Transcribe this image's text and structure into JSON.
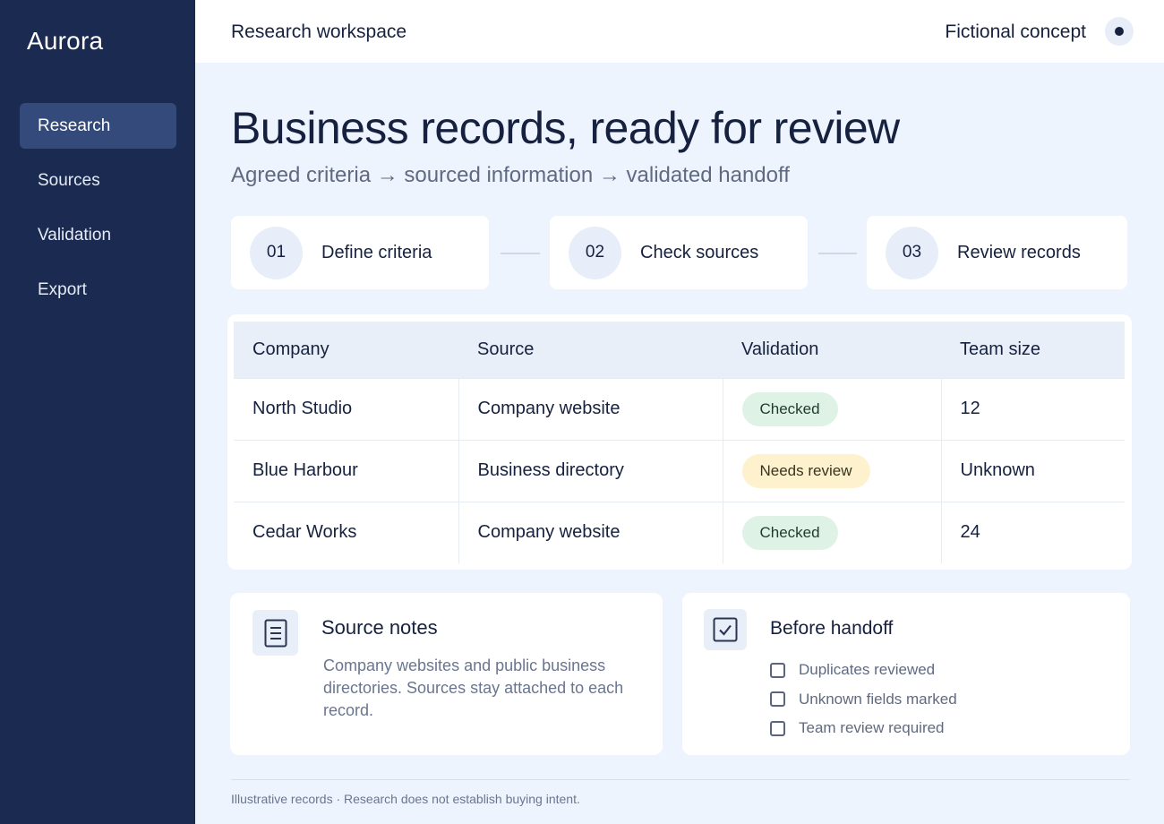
{
  "app": {
    "brand": "Aurora"
  },
  "sidebar": {
    "items": [
      {
        "label": "Research",
        "active": true
      },
      {
        "label": "Sources",
        "active": false
      },
      {
        "label": "Validation",
        "active": false
      },
      {
        "label": "Export",
        "active": false
      }
    ]
  },
  "topbar": {
    "workspace": "Research workspace",
    "concept_label": "Fictional concept"
  },
  "hero": {
    "title": "Business records, ready for review",
    "subtitle": "Agreed criteria → sourced information → validated handoff"
  },
  "steps": [
    {
      "number": "01",
      "label": "Define criteria"
    },
    {
      "number": "02",
      "label": "Check sources"
    },
    {
      "number": "03",
      "label": "Review records"
    }
  ],
  "table": {
    "columns": [
      "Company",
      "Source",
      "Validation",
      "Team size"
    ],
    "rows": [
      {
        "company": "North Studio",
        "source": "Company website",
        "validation": "Checked",
        "status": "checked",
        "team_size": "12"
      },
      {
        "company": "Blue Harbour",
        "source": "Business directory",
        "validation": "Needs review",
        "status": "review",
        "team_size": "Unknown"
      },
      {
        "company": "Cedar Works",
        "source": "Company website",
        "validation": "Checked",
        "status": "checked",
        "team_size": "24"
      }
    ]
  },
  "source_notes": {
    "title": "Source notes",
    "body": "Company websites and public business directories. Sources stay attached to each record."
  },
  "handoff": {
    "title": "Before handoff",
    "items": [
      {
        "label": "Duplicates reviewed",
        "checked": false
      },
      {
        "label": "Unknown fields marked",
        "checked": false
      },
      {
        "label": "Team review required",
        "checked": false
      }
    ]
  },
  "footer": {
    "note": "Illustrative records · Research does not establish buying intent."
  },
  "colors": {
    "sidebar": "#1b2a50",
    "sidebar_active": "#344a7a",
    "background": "#eef4fd",
    "badge_checked": "#def3e6",
    "badge_review": "#fdf2cd"
  }
}
